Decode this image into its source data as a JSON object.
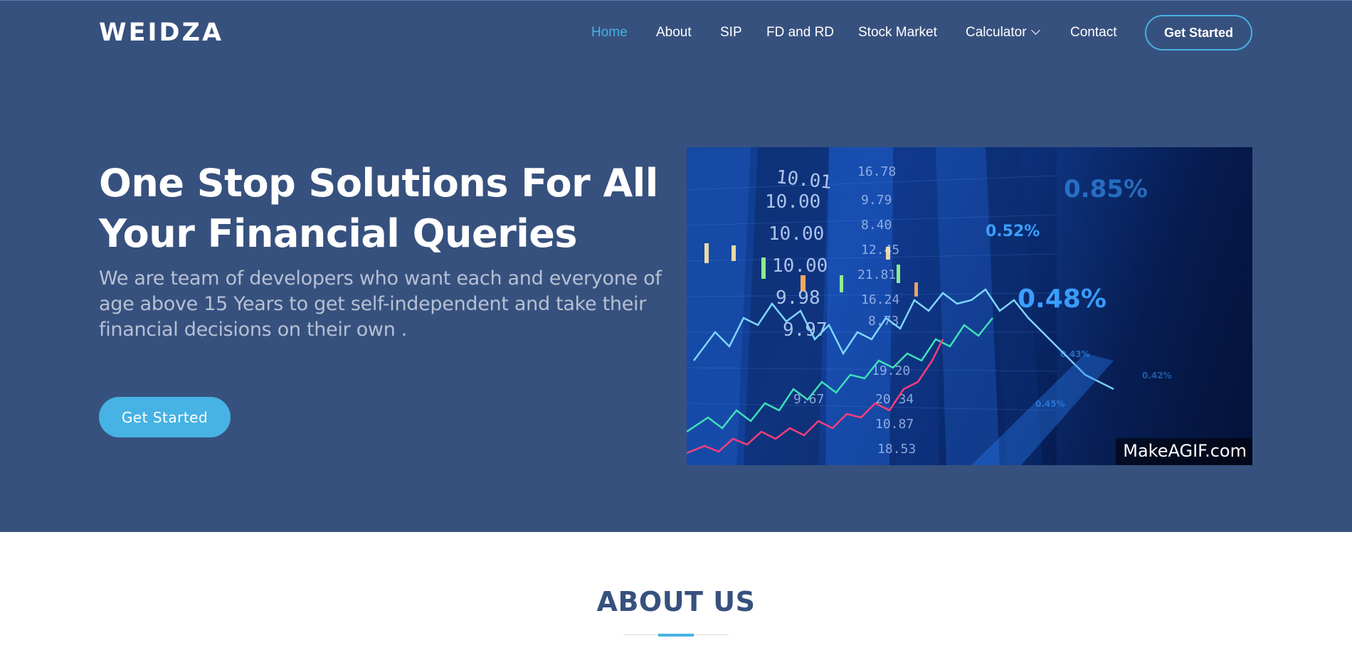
{
  "brand": {
    "logo": "WEIDZA"
  },
  "nav": {
    "items": [
      {
        "label": "Home",
        "active": true
      },
      {
        "label": "About"
      },
      {
        "label": "SIP"
      },
      {
        "label": "FD and RD"
      },
      {
        "label": "Stock Market"
      },
      {
        "label": "Calculator",
        "dropdown": true,
        "icon": "chevron-down-icon"
      },
      {
        "label": "Contact"
      }
    ],
    "cta_label": "Get Started"
  },
  "hero": {
    "title": "One Stop Solutions For All Your Financial Queries",
    "subtitle": "We are team of developers who want each and everyone of age above 15 Years to get self-independent and take their financial decisions on their own .",
    "cta_label": "Get Started",
    "image": {
      "watermark": "MakeAGIF.com",
      "ticker_values": [
        "10.01",
        "10.00",
        "10.00",
        "10.00",
        "9.98",
        "9.97",
        "16.78",
        "9.79",
        "8.40",
        "12.45",
        "21.81",
        "16.24",
        "8.73",
        "19.20",
        "20.34",
        "10.87",
        "18.53",
        "9.67"
      ],
      "percent_values": [
        "0.85%",
        "0.52%",
        "0.48%",
        "0.43%",
        "0.45%",
        "0.42%"
      ]
    }
  },
  "about": {
    "title": "ABOUT US"
  },
  "colors": {
    "hero_bg": "#37517e",
    "accent": "#47b2e4",
    "text_light": "#ffffff",
    "subtitle": "#b6c0d4"
  }
}
